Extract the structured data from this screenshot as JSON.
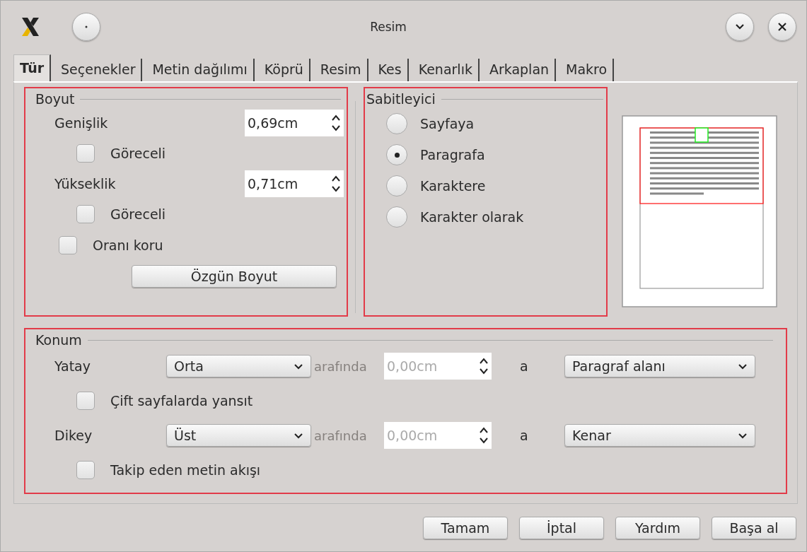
{
  "window": {
    "title": "Resim"
  },
  "tabs": [
    {
      "label": "Tür",
      "selected": true
    },
    {
      "label": "Seçenekler",
      "selected": false
    },
    {
      "label": "Metin dağılımı",
      "selected": false
    },
    {
      "label": "Köprü",
      "selected": false
    },
    {
      "label": "Resim",
      "selected": false
    },
    {
      "label": "Kes",
      "selected": false
    },
    {
      "label": "Kenarlık",
      "selected": false
    },
    {
      "label": "Arkaplan",
      "selected": false
    },
    {
      "label": "Makro",
      "selected": false
    }
  ],
  "size": {
    "title": "Boyut",
    "rows": [
      {
        "kind": "spin",
        "label": "Genişlik",
        "value": "0,69cm"
      },
      {
        "kind": "check",
        "label": "Göreceli",
        "checked": false
      },
      {
        "kind": "spin",
        "label": "Yükseklik",
        "value": "0,71cm"
      },
      {
        "kind": "check",
        "label": "Göreceli",
        "checked": false
      },
      {
        "kind": "check_outer",
        "label": "Oranı koru",
        "checked": false
      }
    ],
    "original_size_button": "Özgün Boyut"
  },
  "anchor": {
    "title": "Sabitleyici",
    "options": [
      {
        "label": "Sayfaya",
        "selected": false
      },
      {
        "label": "Paragrafa",
        "selected": true
      },
      {
        "label": "Karaktere",
        "selected": false
      },
      {
        "label": "Karakter olarak",
        "selected": false
      }
    ]
  },
  "position": {
    "title": "Konum",
    "rows": [
      {
        "kind": "align",
        "label": "Yatay",
        "value": "Orta",
        "by_label": "arafında",
        "by_value": "0,00cm",
        "disabled": true,
        "to_label": "a",
        "to_value": "Paragraf alanı"
      },
      {
        "kind": "check",
        "label": "Çift sayfalarda yansıt",
        "checked": false
      },
      {
        "kind": "align",
        "label": "Dikey",
        "value": "Üst",
        "by_label": "arafında",
        "by_value": "0,00cm",
        "disabled": true,
        "to_label": "a",
        "to_value": "Kenar"
      },
      {
        "kind": "check",
        "label": "Takip eden metin akışı",
        "checked": false
      }
    ]
  },
  "buttons": [
    "Tamam",
    "İptal",
    "Yardım",
    "Başa al"
  ]
}
